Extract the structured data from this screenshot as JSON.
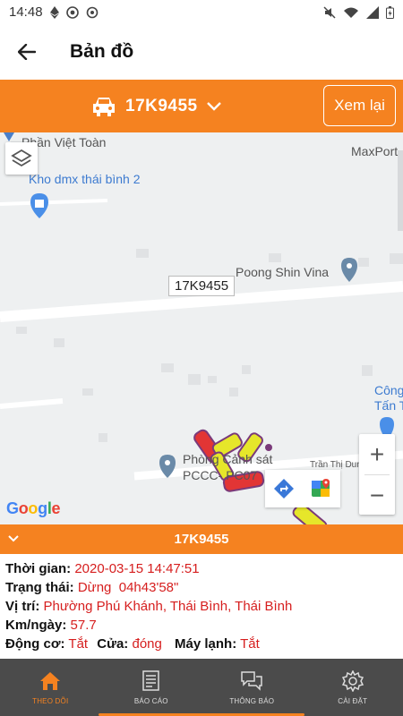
{
  "status_bar": {
    "time": "14:48"
  },
  "app_bar": {
    "title": "Bản đồ"
  },
  "vehicle_bar": {
    "plate": "17K9455",
    "review_label": "Xem lại"
  },
  "map": {
    "labels": {
      "phan_viet_toan": "Phần Việt Toàn",
      "maxport": "MaxPort",
      "kho_dmx": "Kho dmx thái bình 2",
      "poong_shin": "Poong Shin Vina",
      "cong_tan_1": "Công",
      "cong_tan_2": "Tấn T",
      "police_1": "Phòng Cảnh sát",
      "police_2": "PCCC- PC07",
      "tran_thi_dung": "Trần Thị Dung",
      "google": "Google"
    },
    "marker_label": "17K9455",
    "zoom_in": "+",
    "zoom_out": "−"
  },
  "info": {
    "title": "17K9455",
    "time_label": "Thời gian:",
    "time_value": "2020-03-15 14:47:51",
    "status_label": "Trạng thái:",
    "status_value": "Dừng  04h43'58\"",
    "location_label": "Vị trí:",
    "location_value": "Phường Phú Khánh, Thái Bình, Thái Bình",
    "km_label": "Km/ngày:",
    "km_value": "57.7",
    "engine_label": "Động cơ:",
    "engine_value": "Tắt",
    "door_label": "Cửa:",
    "door_value": "đóng",
    "ac_label": "Máy lạnh:",
    "ac_value": "Tắt"
  },
  "bottom_nav": {
    "items": [
      {
        "label": "THEO DÕI",
        "icon": "home-icon",
        "active": true
      },
      {
        "label": "BÁO CÁO",
        "icon": "report-icon",
        "active": false
      },
      {
        "label": "THÔNG BÁO",
        "icon": "chat-icon",
        "active": false
      },
      {
        "label": "CÀI ĐẶT",
        "icon": "gear-icon",
        "active": false
      }
    ]
  },
  "colors": {
    "accent": "#f58220",
    "nav_bg": "#4b4b4b",
    "value_red": "#d61e1e"
  }
}
